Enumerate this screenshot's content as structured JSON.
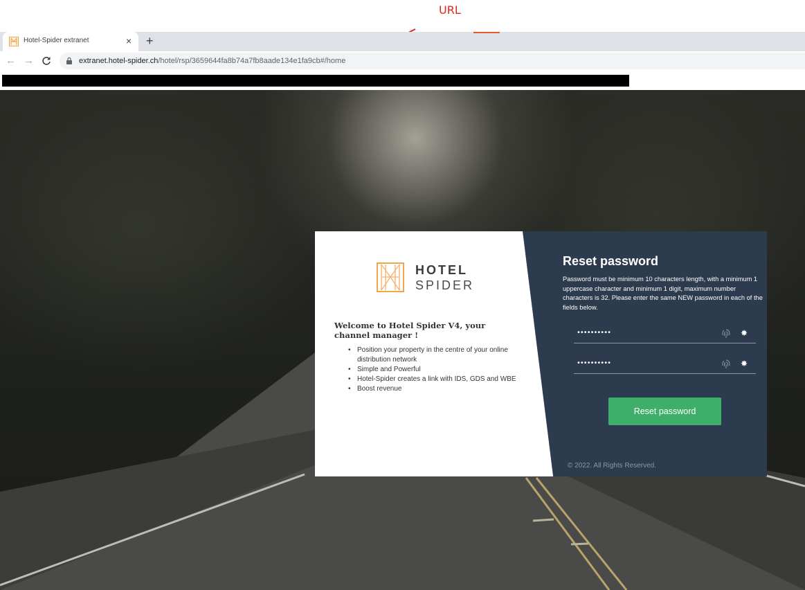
{
  "annotation": {
    "label": "URL",
    "color": "#e0261c"
  },
  "browser": {
    "tab_title": "Hotel-Spider extranet",
    "tab_close": "×",
    "new_tab": "+",
    "url_domain": "extranet.hotel-spider.ch",
    "url_path": "/hotel/rsp/3659644fa8b74a7fb8aade134e1fa9cb#/home",
    "icons": {
      "back": "arrow-left-icon",
      "forward": "arrow-right-icon",
      "reload": "reload-icon",
      "lock": "lock-icon"
    }
  },
  "brand": {
    "word1": "HOTEL",
    "word2": "SPIDER",
    "accent": "#f0a64a"
  },
  "left_panel": {
    "welcome": "Welcome to Hotel Spider V4, your channel manager !",
    "bullets": [
      "Position your property in the centre of your online distribution network",
      "Simple and Powerful",
      "Hotel-Spider creates a link with IDS, GDS and WBE",
      "Boost revenue"
    ]
  },
  "right_panel": {
    "title": "Reset password",
    "description": "Password must be minimum 10 characters length, with a minimum 1 uppercase character and minimum 1 digit, maximum number characters is 32. Please enter the same NEW password in each of the fields below.",
    "password_1": "••••••••••",
    "password_2": "••••••••••",
    "button_label": "Reset password",
    "button_color": "#3fae6b",
    "panel_color": "#2d3b4e",
    "copyright": "© 2022. All Rights Reserved."
  }
}
